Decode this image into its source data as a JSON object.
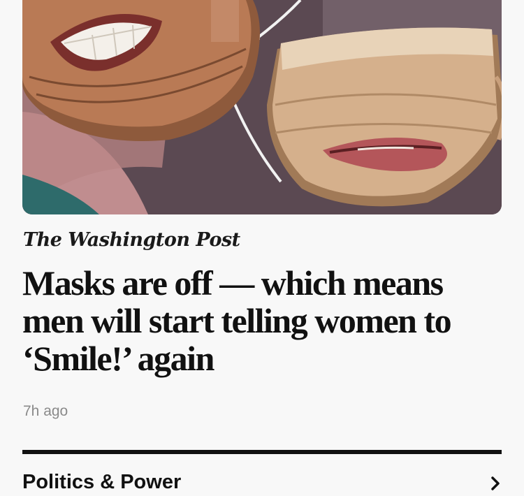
{
  "article": {
    "publisher": "The Washington Post",
    "headline": "Masks are off — which means men will start telling women to ‘Smile!’ again",
    "timestamp": "7h ago"
  },
  "section": {
    "label": "Politics & Power",
    "icon": "chevron-right-icon"
  },
  "colors": {
    "background": "#f8f8f8",
    "text": "#111111",
    "timestamp": "#8a8a8a",
    "divider": "#111111"
  }
}
